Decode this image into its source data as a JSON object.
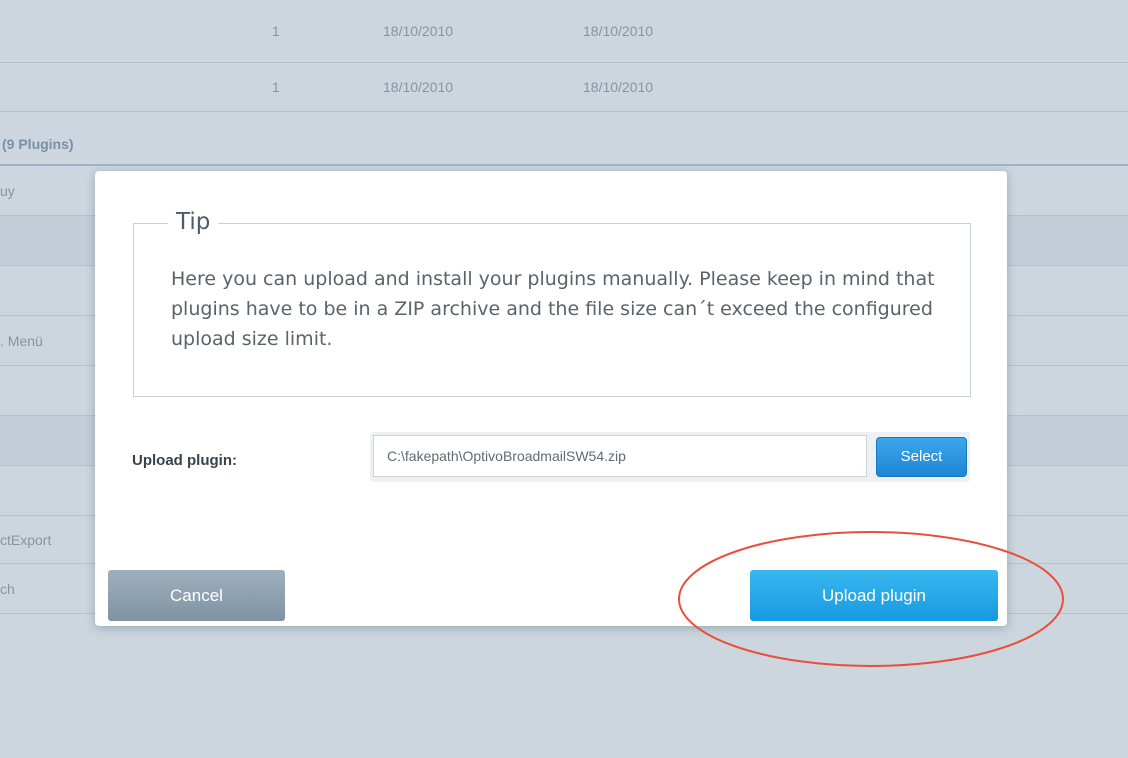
{
  "background": {
    "rows_top": [
      {
        "count": "1",
        "date_installed": "18/10/2010",
        "date_updated": "18/10/2010"
      },
      {
        "count": "1",
        "date_installed": "18/10/2010",
        "date_updated": "18/10/2010"
      }
    ],
    "section_title": "(9 Plugins)",
    "rows_bottom": [
      "uy",
      "",
      "",
      ". Menü",
      "",
      "",
      "",
      "ctExport",
      "ch"
    ]
  },
  "dialog": {
    "tip_title": "Tip",
    "tip_text": "Here you can upload and install your plugins manually. Please keep in mind that plugins have to be in a ZIP archive and the file size can´t exceed the configured upload size limit.",
    "upload_label": "Upload plugin:",
    "file_value": "C:\\fakepath\\OptivoBroadmailSW54.zip",
    "select_label": "Select",
    "cancel_label": "Cancel",
    "upload_button_label": "Upload plugin"
  },
  "colors": {
    "primary_button": "#1799e0",
    "cancel_button": "#8a9dad",
    "annotation": "#e8503a",
    "overlay": "#cdd6de"
  }
}
